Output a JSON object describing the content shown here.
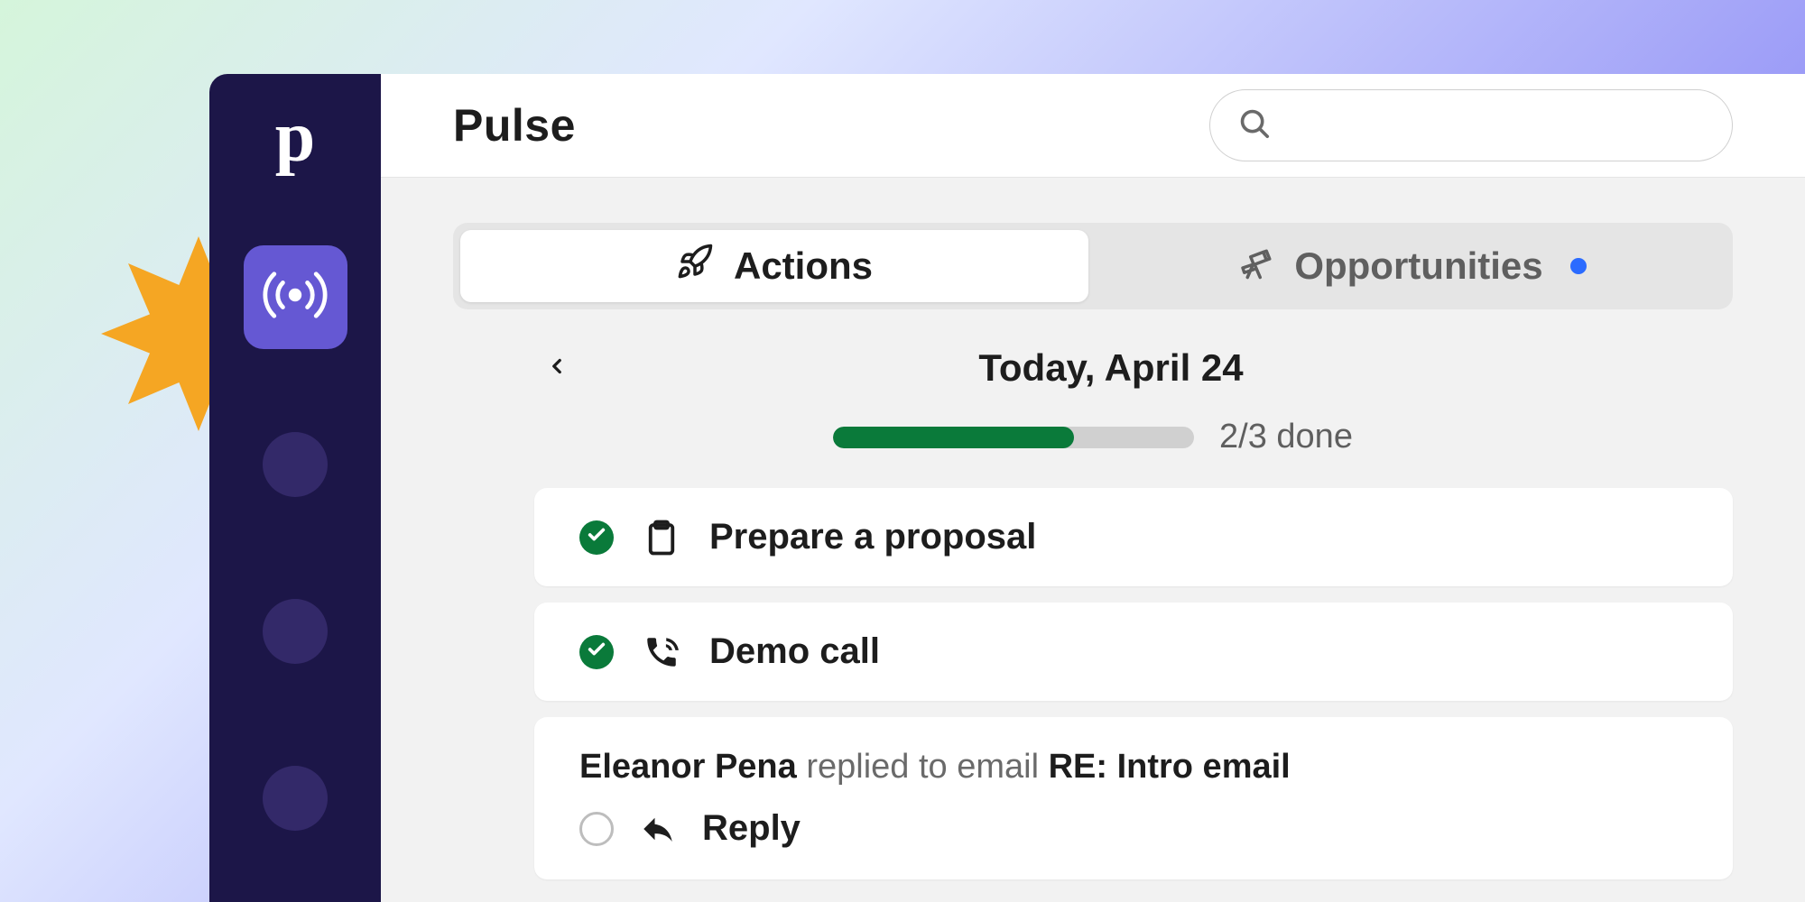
{
  "header": {
    "title": "Pulse"
  },
  "tabs": {
    "actions": "Actions",
    "opportunities": "Opportunities",
    "opportunities_indicator": true
  },
  "date": {
    "label": "Today, April 24"
  },
  "progress": {
    "done": 2,
    "total": 3,
    "label": "2/3 done",
    "percent": 66.7
  },
  "tasks": [
    {
      "title": "Prepare a proposal",
      "done": true,
      "icon": "clipboard"
    },
    {
      "title": "Demo call",
      "done": true,
      "icon": "phone"
    }
  ],
  "reply_event": {
    "who": "Eleanor Pena",
    "verb": "replied to email",
    "subject": "RE: Intro email",
    "action_label": "Reply"
  }
}
